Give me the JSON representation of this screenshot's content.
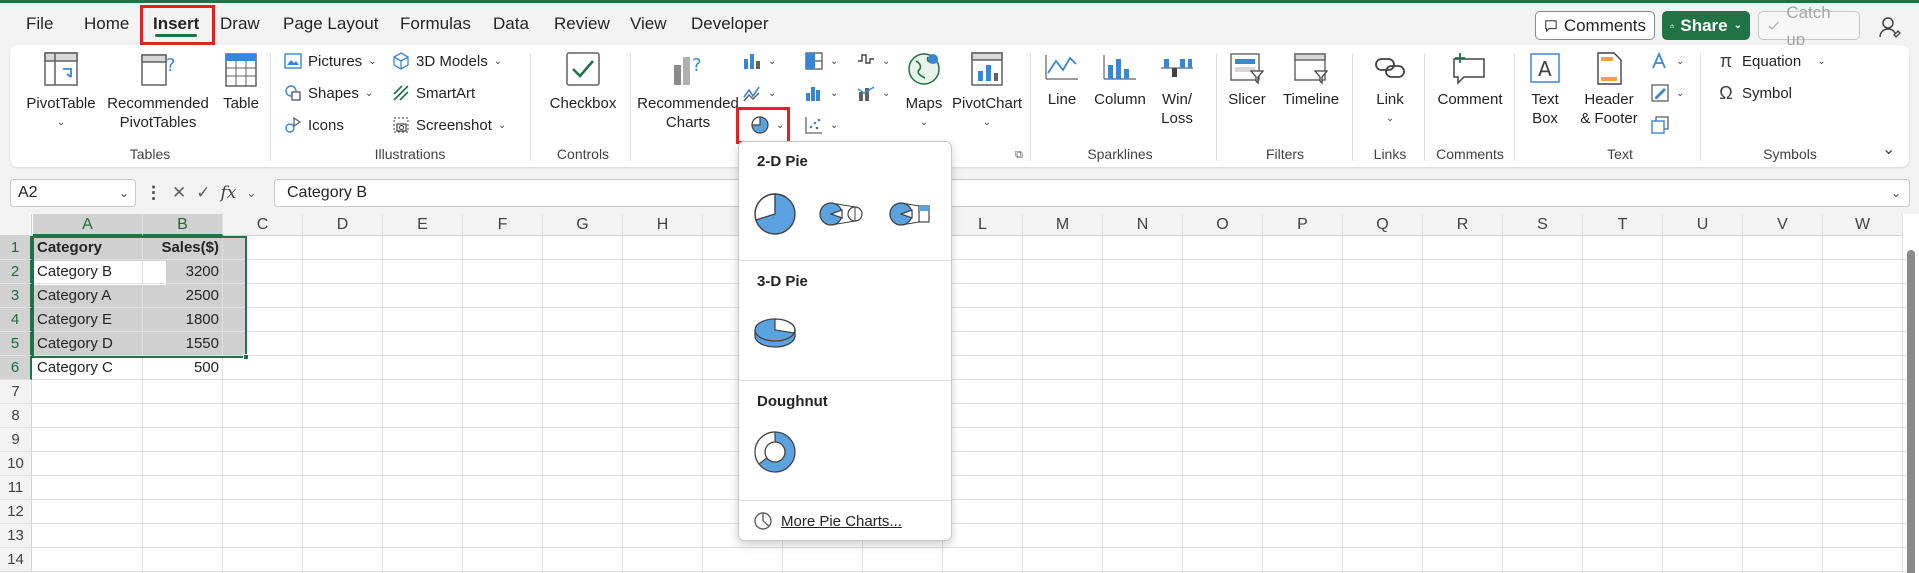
{
  "menu": {
    "tabs": [
      "File",
      "Home",
      "Insert",
      "Draw",
      "Page Layout",
      "Formulas",
      "Data",
      "Review",
      "View",
      "Developer"
    ],
    "active_tab": "Insert",
    "comments_label": "Comments",
    "share_label": "Share",
    "catchup_label": "Catch up"
  },
  "ribbon": {
    "tables": {
      "pivottable": "PivotTable",
      "recommended_line1": "Recommended",
      "recommended_line2": "PivotTables",
      "table": "Table",
      "group": "Tables"
    },
    "illustrations": {
      "pictures": "Pictures",
      "shapes": "Shapes",
      "icons": "Icons",
      "models": "3D Models",
      "smartart": "SmartArt",
      "screenshot": "Screenshot",
      "group": "Illustrations"
    },
    "controls": {
      "checkbox": "Checkbox",
      "group": "Controls"
    },
    "charts": {
      "recommended_line1": "Recommended",
      "recommended_line2": "Charts",
      "maps": "Maps",
      "pivotchart": "PivotChart"
    },
    "sparklines": {
      "line": "Line",
      "column": "Column",
      "winloss_line1": "Win/",
      "winloss_line2": "Loss",
      "group": "Sparklines"
    },
    "filters": {
      "slicer": "Slicer",
      "timeline": "Timeline",
      "group": "Filters"
    },
    "links": {
      "link": "Link",
      "group": "Links"
    },
    "comments": {
      "comment": "Comment",
      "group": "Comments"
    },
    "text": {
      "textbox_line1": "Text",
      "textbox_line2": "Box",
      "header_line1": "Header",
      "header_line2": "& Footer",
      "group": "Text"
    },
    "symbols": {
      "equation": "Equation",
      "symbol": "Symbol",
      "group": "Symbols"
    }
  },
  "formula_bar": {
    "name_box": "A2",
    "fx": "fx",
    "content": "Category B"
  },
  "sheet": {
    "columns": [
      "A",
      "B",
      "C",
      "D",
      "E",
      "F",
      "G",
      "H",
      "I",
      "J",
      "K",
      "L",
      "M",
      "N",
      "O",
      "P",
      "Q",
      "R",
      "S",
      "T",
      "U",
      "V",
      "W"
    ],
    "rows": [
      "1",
      "2",
      "3",
      "4",
      "5",
      "6",
      "7",
      "8",
      "9",
      "10",
      "11",
      "12",
      "13",
      "14"
    ],
    "cells": [
      [
        "Category",
        "Sales($)"
      ],
      [
        "Category B",
        "3200"
      ],
      [
        "Category A",
        "2500"
      ],
      [
        "Category E",
        "1800"
      ],
      [
        "Category D",
        "1550"
      ],
      [
        "Category C",
        "500"
      ]
    ]
  },
  "pie_dropdown": {
    "section_2d": "2-D Pie",
    "section_3d": "3-D Pie",
    "section_doughnut": "Doughnut",
    "more": "More Pie Charts..."
  },
  "colors": {
    "accent": "#217346",
    "highlight": "#e02424",
    "chart_blue": "#5ba3e0"
  }
}
